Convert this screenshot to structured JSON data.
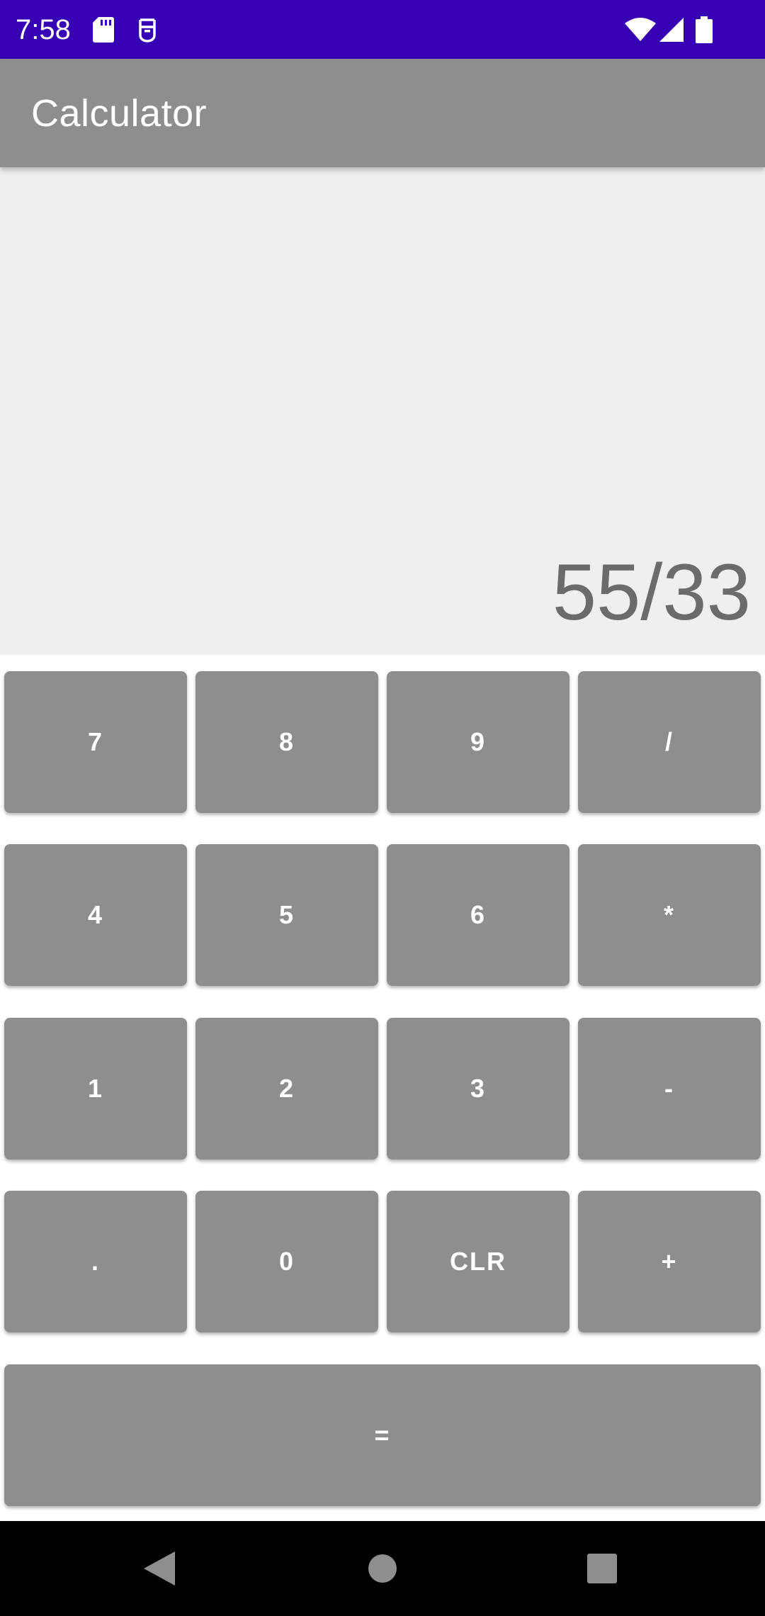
{
  "status_bar": {
    "time": "7:58",
    "icons": [
      "sd-card-icon",
      "debug-icon",
      "wifi-icon",
      "cell-signal-icon",
      "battery-icon"
    ]
  },
  "app_bar": {
    "title": "Calculator"
  },
  "display": {
    "expression": "55/33"
  },
  "keypad": {
    "rows": [
      [
        "7",
        "8",
        "9",
        "/"
      ],
      [
        "4",
        "5",
        "6",
        "*"
      ],
      [
        "1",
        "2",
        "3",
        "-"
      ],
      [
        ".",
        "0",
        "CLR",
        "+"
      ]
    ],
    "equals": "="
  },
  "nav_bar": {
    "buttons": [
      "back-icon",
      "home-icon",
      "recents-icon"
    ]
  },
  "colors": {
    "status_bar": "#3700b3",
    "app_bar": "#8e8e8e",
    "display_bg": "#efefef",
    "display_text": "#6b6b6b",
    "key_bg": "#8e8e8e",
    "key_text": "#ffffff",
    "nav_bar": "#000000"
  }
}
